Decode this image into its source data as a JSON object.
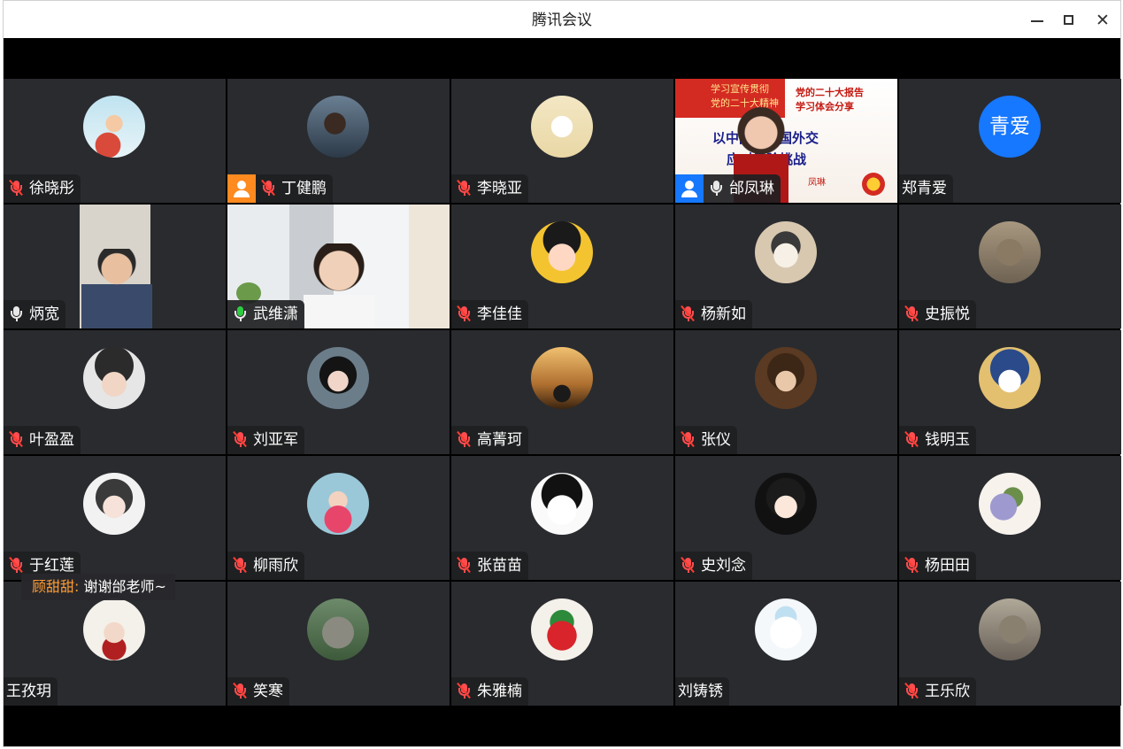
{
  "window": {
    "title": "腾讯会议",
    "minimize_label": "—",
    "maximize_label": "□",
    "close_label": "✕"
  },
  "participants": [
    {
      "name": "徐晓彤",
      "mic": "muted"
    },
    {
      "name": "丁健鹏",
      "mic": "muted",
      "badge": "host"
    },
    {
      "name": "李晓亚",
      "mic": "muted"
    },
    {
      "name": "邰凤琳",
      "mic": "on",
      "badge": "cohost",
      "video": true
    },
    {
      "name": "郑青爱",
      "mic": "none",
      "avatar_text": "青爱"
    },
    {
      "name": "炳宽",
      "mic": "on",
      "video": true
    },
    {
      "name": "武维潇",
      "mic": "talking",
      "video": true
    },
    {
      "name": "李佳佳",
      "mic": "muted"
    },
    {
      "name": "杨新如",
      "mic": "muted"
    },
    {
      "name": "史振悦",
      "mic": "muted"
    },
    {
      "name": "叶盈盈",
      "mic": "muted"
    },
    {
      "name": "刘亚军",
      "mic": "muted"
    },
    {
      "name": "高菁珂",
      "mic": "muted"
    },
    {
      "name": "张仪",
      "mic": "muted"
    },
    {
      "name": "钱明玉",
      "mic": "muted"
    },
    {
      "name": "于红莲",
      "mic": "muted"
    },
    {
      "name": "柳雨欣",
      "mic": "muted"
    },
    {
      "name": "张苗苗",
      "mic": "muted"
    },
    {
      "name": "史刘念",
      "mic": "muted"
    },
    {
      "name": "杨田田",
      "mic": "muted"
    },
    {
      "name": "王孜玥",
      "mic": "none"
    },
    {
      "name": "笑寒",
      "mic": "muted"
    },
    {
      "name": "朱雅楠",
      "mic": "muted"
    },
    {
      "name": "刘铸锈",
      "mic": "none"
    },
    {
      "name": "王乐欣",
      "mic": "muted"
    }
  ],
  "slide": {
    "tag_left": "学习宣传贯彻",
    "tag_left_2": "党的二十大精神",
    "header_right": "党的二十大报告",
    "header_right_2": "学习体会分享",
    "line1": "以中国式大国外交",
    "line2": "应对风险挑战",
    "presenter": "凤琳"
  },
  "chat": {
    "from": "顾甜甜:",
    "message": "谢谢邰老师~"
  },
  "colors": {
    "tile_bg": "#292b2f",
    "stage_bg": "#000000",
    "accent_blue": "#1677ff",
    "host_orange": "#ff8a1f",
    "muted_red": "#ff4d4f",
    "talking_green": "#2ecc40"
  }
}
